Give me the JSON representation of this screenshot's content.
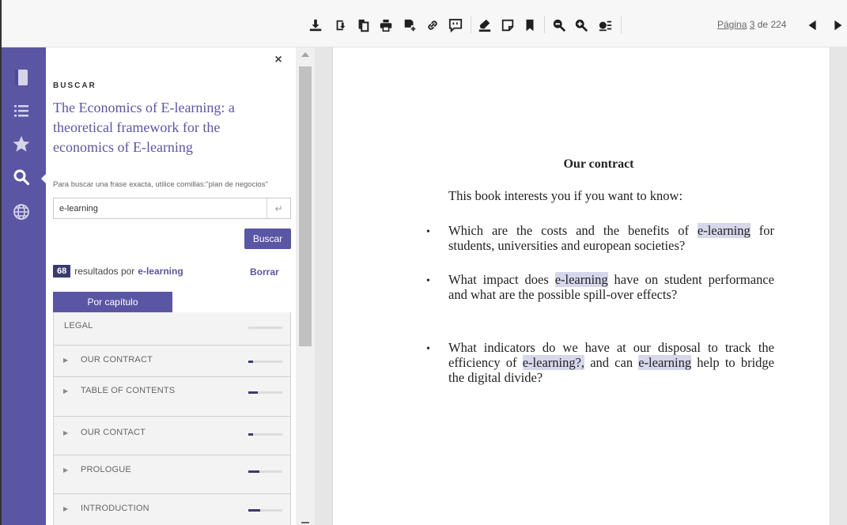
{
  "toolbar": {
    "icons": [
      "download-icon",
      "download-chapter-icon",
      "copy-icon",
      "print-icon",
      "add-note-icon",
      "link-icon",
      "comment-icon",
      "highlighter-icon",
      "note-icon",
      "bookmark-icon",
      "zoom-out-icon",
      "zoom-in-icon",
      "view-settings-icon"
    ],
    "page_prefix": "Página",
    "page_current": "3",
    "page_of": "de",
    "page_total": "224",
    "prev_icon": "triangle-left-icon",
    "next_icon": "triangle-right-icon"
  },
  "rail": {
    "items": [
      {
        "icon": "book-icon"
      },
      {
        "icon": "list-icon"
      },
      {
        "icon": "star-icon"
      },
      {
        "icon": "search-icon",
        "active": true
      },
      {
        "icon": "globe-icon"
      }
    ],
    "background": "#5b56a3"
  },
  "panel": {
    "close_label": "×",
    "heading": "BUSCAR",
    "book_title": "The Economics of E-learning: a theoretical framework for the economics of E-learning",
    "hint": "Para buscar una frase exacta, utilice comillas:\"plan de negocios\"",
    "search_value": "e-learning",
    "enter_symbol": "↵",
    "search_button": "Buscar",
    "results_count": "68",
    "results_text": "resultados por",
    "results_term": "e-learning",
    "clear_label": "Borrar",
    "tab_label": "Por capítulo",
    "chapters": [
      {
        "label": "LEGAL",
        "expandable": false,
        "relevance": 0.0
      },
      {
        "label": "OUR CONTRACT",
        "expandable": true,
        "relevance": 0.15
      },
      {
        "label": "TABLE OF CONTENTS",
        "expandable": true,
        "relevance": 0.28
      },
      {
        "label": "OUR CONTACT",
        "expandable": true,
        "relevance": 0.15
      },
      {
        "label": "PROLOGUE",
        "expandable": true,
        "relevance": 0.33
      },
      {
        "label": "INTRODUCTION",
        "expandable": true,
        "relevance": 0.35
      }
    ],
    "accent": "#5b56a3"
  },
  "document": {
    "heading": "Our contract",
    "intro": "This book interests you if you want to know:",
    "bullet_symbol": "•",
    "bullets": [
      {
        "pre": "Which are the costs and the benefits of ",
        "hl1": "e-learning",
        "mid": " for students, universities and european societies?"
      },
      {
        "pre": "What impact does ",
        "hl1": "e-learning",
        "mid": " have on student performance and what are the possible spill-over effects?"
      },
      {
        "pre": "What indicators do we have at our disposal to track the efficiency of ",
        "hl1": "e-learning?,",
        "mid": " and can ",
        "hl2": "e-learning",
        "post": " help to bridge the  digital divide?"
      }
    ],
    "highlight_color": "#d7d7ec"
  }
}
